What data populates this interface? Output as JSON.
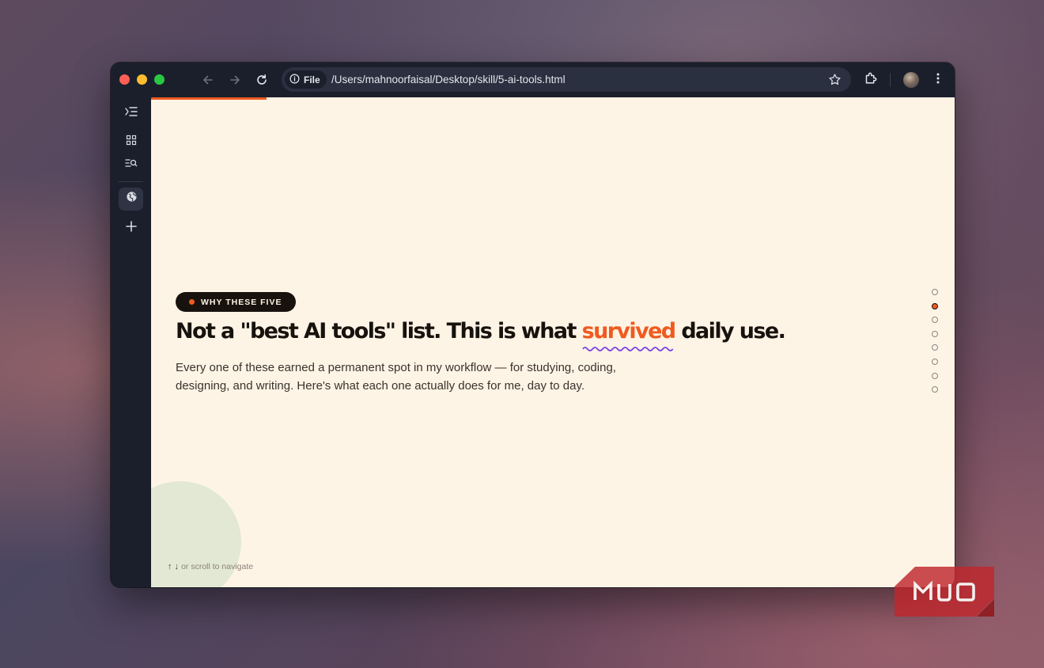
{
  "browser": {
    "url_chip": "File",
    "url": "/Users/mahnoorfaisal/Desktop/skill/5-ai-tools.html",
    "icons": [
      "back-arrow-icon",
      "forward-arrow-icon",
      "reload-icon",
      "info-icon",
      "bookmark-star-icon",
      "extensions-puzzle-icon",
      "profile-avatar",
      "menu-kebab-icon"
    ]
  },
  "sidebar": {
    "items": [
      "collapse-sidebar-icon",
      "tab-grid-icon",
      "tab-search-icon",
      "globe-icon",
      "new-tab-plus-icon"
    ]
  },
  "slide": {
    "eyebrow": "WHY THESE FIVE",
    "headline_before": "Not a \"best AI tools\" list. This is what ",
    "headline_highlight": "survived",
    "headline_after": " daily use.",
    "body": "Every one of these earned a permanent spot in my workflow — for studying, coding, designing, and writing. Here's what each one actually does for me, day to day.",
    "scroll_hint_arrows": "↑ ↓",
    "scroll_hint": "or scroll to navigate",
    "nav_dots_count": 8,
    "active_dot_index": 1
  },
  "colors": {
    "accent": "#f05a1f",
    "squiggle": "#7b3fe4",
    "page_bg": "#fef4e6",
    "ink": "#17120d",
    "chrome": "#1b1f2c"
  },
  "watermark": {
    "text": "MUO"
  }
}
